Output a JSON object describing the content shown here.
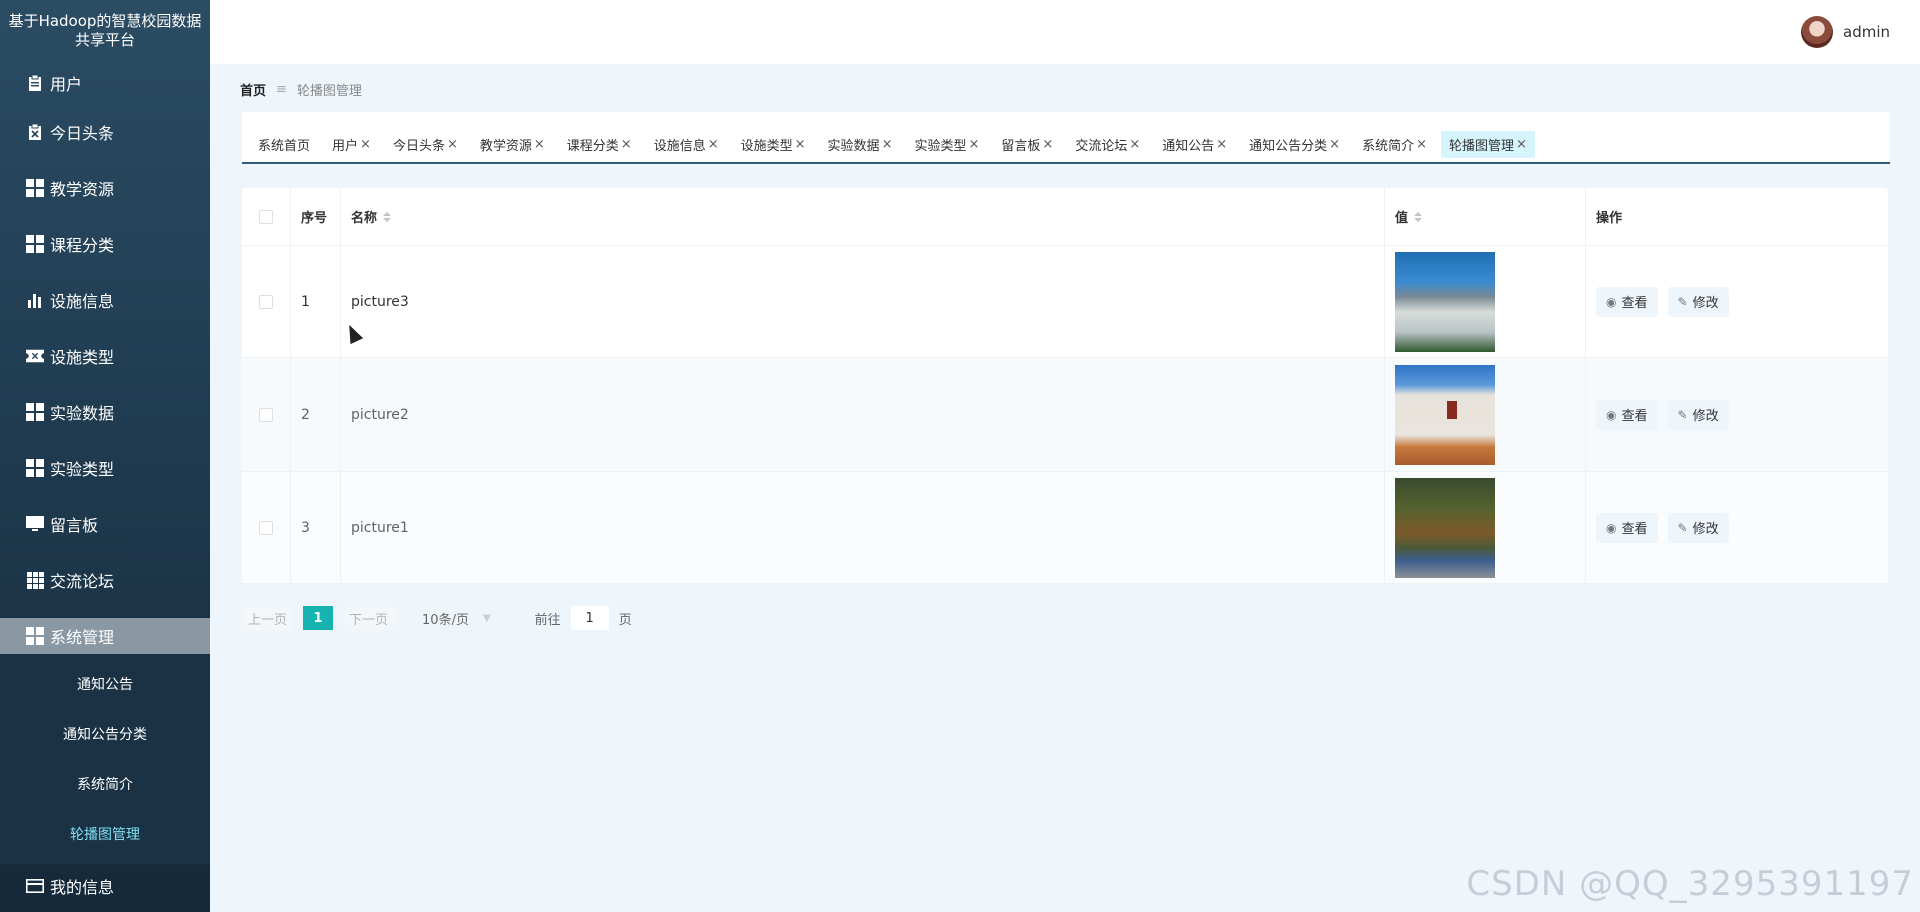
{
  "app": {
    "title": "基于Hadoop的智慧校园数据共享平台"
  },
  "sidebar": {
    "items": [
      {
        "label": "用户",
        "icon": "clipboard-icon"
      },
      {
        "label": "今日头条",
        "icon": "clipboard-x-icon"
      },
      {
        "label": "教学资源",
        "icon": "grid-icon"
      },
      {
        "label": "课程分类",
        "icon": "grid-icon"
      },
      {
        "label": "设施信息",
        "icon": "bar-chart-icon"
      },
      {
        "label": "设施类型",
        "icon": "ticket-icon"
      },
      {
        "label": "实验数据",
        "icon": "grid-icon"
      },
      {
        "label": "实验类型",
        "icon": "grid-icon"
      },
      {
        "label": "留言板",
        "icon": "monitor-icon"
      },
      {
        "label": "交流论坛",
        "icon": "grid9-icon"
      },
      {
        "label": "系统管理",
        "icon": "grid-icon"
      }
    ],
    "submenu": [
      "通知公告",
      "通知公告分类",
      "系统简介",
      "轮播图管理"
    ],
    "bottom_item": {
      "label": "我的信息",
      "icon": "card-icon"
    }
  },
  "header": {
    "username": "admin"
  },
  "breadcrumb": {
    "home": "首页",
    "sep": "≡",
    "current": "轮播图管理"
  },
  "tabs": [
    {
      "label": "系统首页",
      "closable": false
    },
    {
      "label": "用户",
      "closable": true
    },
    {
      "label": "今日头条",
      "closable": true
    },
    {
      "label": "教学资源",
      "closable": true
    },
    {
      "label": "课程分类",
      "closable": true
    },
    {
      "label": "设施信息",
      "closable": true
    },
    {
      "label": "设施类型",
      "closable": true
    },
    {
      "label": "实验数据",
      "closable": true
    },
    {
      "label": "实验类型",
      "closable": true
    },
    {
      "label": "留言板",
      "closable": true
    },
    {
      "label": "交流论坛",
      "closable": true
    },
    {
      "label": "通知公告",
      "closable": true
    },
    {
      "label": "通知公告分类",
      "closable": true
    },
    {
      "label": "系统简介",
      "closable": true
    },
    {
      "label": "轮播图管理",
      "closable": true,
      "active": true
    }
  ],
  "tab_close_glyph": "×",
  "table": {
    "columns": {
      "index": "序号",
      "name": "名称",
      "value": "值",
      "ops": "操作"
    },
    "rows": [
      {
        "index": "1",
        "name": "picture3"
      },
      {
        "index": "2",
        "name": "picture2"
      },
      {
        "index": "3",
        "name": "picture1"
      }
    ],
    "view_label": "查看",
    "edit_label": "修改"
  },
  "pagination": {
    "prev": "上一页",
    "current_page": "1",
    "next": "下一页",
    "page_size": "10条/页",
    "goto_label": "前往",
    "goto_value": "1",
    "page_unit": "页"
  },
  "watermark": "CSDN @QQ_3295391197",
  "colors": {
    "accent": "#17b3b0",
    "active_tab": "#d6f4fb",
    "sidebar": "#1f3a4f"
  }
}
